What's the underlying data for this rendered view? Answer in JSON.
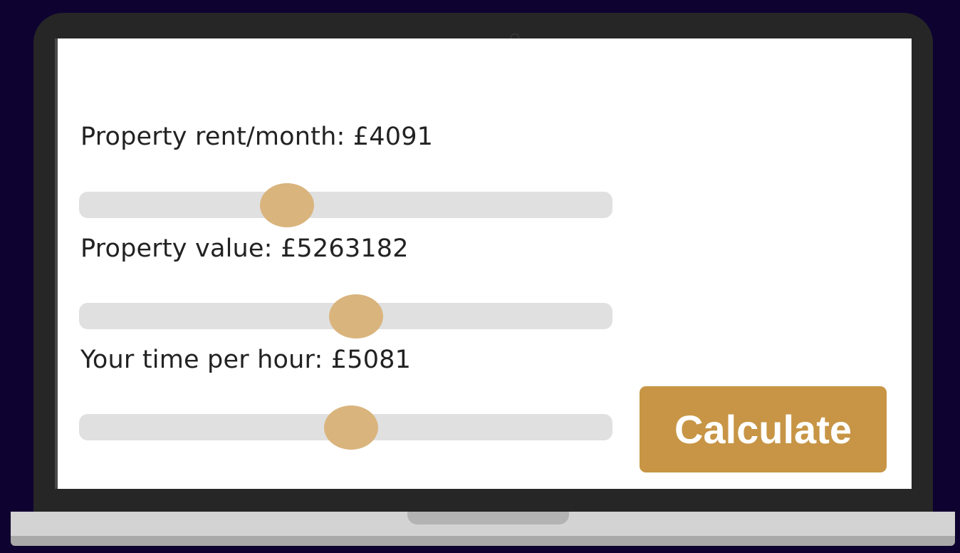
{
  "form": {
    "rent": {
      "label": "Property rent/month: £4091",
      "value": 4091,
      "slider_fraction": 0.39
    },
    "property_value": {
      "label": "Property value: £5263182",
      "value": 5263182,
      "slider_fraction": 0.52
    },
    "time_per_hour": {
      "label": "Your time per hour: £5081",
      "value": 5081,
      "slider_fraction": 0.51
    }
  },
  "calculate_button": {
    "label": "Calculate"
  },
  "colors": {
    "background": "#0e0330",
    "laptop_bezel": "#262626",
    "screen": "#ffffff",
    "slider_track": "#e0e0e0",
    "slider_thumb": "#d9b47d",
    "button": "#c79545",
    "text": "#222222"
  }
}
